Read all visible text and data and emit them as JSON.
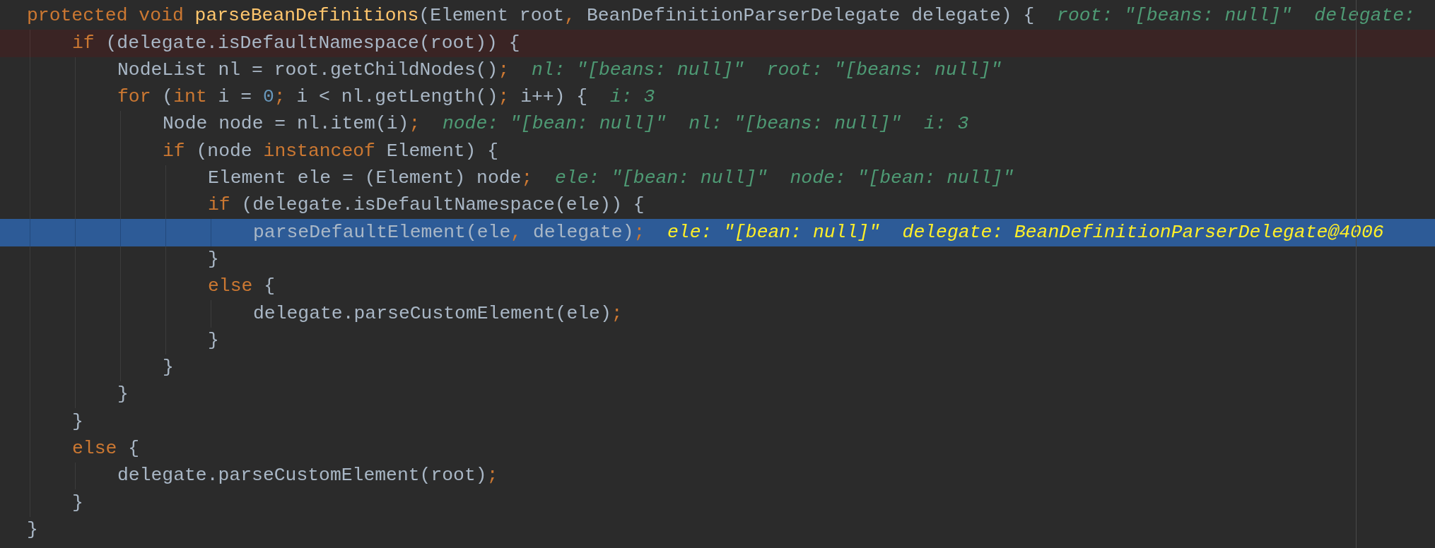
{
  "lines": [
    {
      "breakpoint": false,
      "current": false,
      "tokens": [
        {
          "kind": "keyword",
          "text": "protected void "
        },
        {
          "kind": "declaration",
          "text": "parseBeanDefinitions"
        },
        {
          "kind": "plain",
          "text": "(Element root"
        },
        {
          "kind": "punct",
          "text": ","
        },
        {
          "kind": "plain",
          "text": " BeanDefinitionParserDelegate delegate) {"
        }
      ],
      "values": [
        "root: \"[beans: null]\"",
        "delegate:"
      ],
      "children": [
        {
          "breakpoint": true,
          "current": false,
          "tokens": [
            {
              "kind": "keyword",
              "text": "if"
            },
            {
              "kind": "plain",
              "text": " (delegate.isDefaultNamespace(root)) {"
            }
          ],
          "children": [
            {
              "breakpoint": false,
              "current": false,
              "tokens": [
                {
                  "kind": "plain",
                  "text": "NodeList nl = root.getChildNodes()"
                },
                {
                  "kind": "punct",
                  "text": ";"
                }
              ],
              "values": [
                "nl: \"[beans: null]\"",
                "root: \"[beans: null]\""
              ]
            },
            {
              "breakpoint": false,
              "current": false,
              "tokens": [
                {
                  "kind": "keyword",
                  "text": "for"
                },
                {
                  "kind": "plain",
                  "text": " ("
                },
                {
                  "kind": "keyword",
                  "text": "int"
                },
                {
                  "kind": "plain",
                  "text": " i = "
                },
                {
                  "kind": "number",
                  "text": "0"
                },
                {
                  "kind": "punct",
                  "text": ";"
                },
                {
                  "kind": "plain",
                  "text": " i < nl.getLength()"
                },
                {
                  "kind": "punct",
                  "text": ";"
                },
                {
                  "kind": "plain",
                  "text": " i++) {"
                }
              ],
              "values": [
                "i: 3"
              ],
              "children": [
                {
                  "breakpoint": false,
                  "current": false,
                  "tokens": [
                    {
                      "kind": "plain",
                      "text": "Node node = nl.item(i)"
                    },
                    {
                      "kind": "punct",
                      "text": ";"
                    }
                  ],
                  "values": [
                    "node: \"[bean: null]\"",
                    "nl: \"[beans: null]\"",
                    "i: 3"
                  ]
                },
                {
                  "breakpoint": false,
                  "current": false,
                  "tokens": [
                    {
                      "kind": "keyword",
                      "text": "if"
                    },
                    {
                      "kind": "plain",
                      "text": " (node "
                    },
                    {
                      "kind": "keyword",
                      "text": "instanceof"
                    },
                    {
                      "kind": "plain",
                      "text": " Element) {"
                    }
                  ],
                  "children": [
                    {
                      "breakpoint": false,
                      "current": false,
                      "tokens": [
                        {
                          "kind": "plain",
                          "text": "Element ele = (Element) node"
                        },
                        {
                          "kind": "punct",
                          "text": ";"
                        }
                      ],
                      "values": [
                        "ele: \"[bean: null]\"",
                        "node: \"[bean: null]\""
                      ]
                    },
                    {
                      "breakpoint": false,
                      "current": false,
                      "tokens": [
                        {
                          "kind": "keyword",
                          "text": "if"
                        },
                        {
                          "kind": "plain",
                          "text": " (delegate.isDefaultNamespace(ele)) {"
                        }
                      ],
                      "children": [
                        {
                          "breakpoint": false,
                          "current": true,
                          "tokens": [
                            {
                              "kind": "plain",
                              "text": "parseDefaultElement(ele"
                            },
                            {
                              "kind": "punct",
                              "text": ","
                            },
                            {
                              "kind": "plain",
                              "text": " delegate)"
                            },
                            {
                              "kind": "punct",
                              "text": ";"
                            }
                          ],
                          "values": [
                            "ele: \"[bean: null]\"",
                            "delegate: BeanDefinitionParserDelegate@4006"
                          ]
                        }
                      ]
                    },
                    {
                      "breakpoint": false,
                      "current": false,
                      "tokens": [
                        {
                          "kind": "plain",
                          "text": "}"
                        }
                      ]
                    },
                    {
                      "breakpoint": false,
                      "current": false,
                      "tokens": [
                        {
                          "kind": "keyword",
                          "text": "else"
                        },
                        {
                          "kind": "plain",
                          "text": " {"
                        }
                      ],
                      "children": [
                        {
                          "breakpoint": false,
                          "current": false,
                          "tokens": [
                            {
                              "kind": "plain",
                              "text": "delegate.parseCustomElement(ele)"
                            },
                            {
                              "kind": "punct",
                              "text": ";"
                            }
                          ]
                        }
                      ]
                    },
                    {
                      "breakpoint": false,
                      "current": false,
                      "tokens": [
                        {
                          "kind": "plain",
                          "text": "}"
                        }
                      ]
                    }
                  ]
                },
                {
                  "breakpoint": false,
                  "current": false,
                  "tokens": [
                    {
                      "kind": "plain",
                      "text": "}"
                    }
                  ]
                }
              ]
            },
            {
              "breakpoint": false,
              "current": false,
              "tokens": [
                {
                  "kind": "plain",
                  "text": "}"
                }
              ]
            }
          ]
        },
        {
          "breakpoint": false,
          "current": false,
          "tokens": [
            {
              "kind": "plain",
              "text": "}"
            }
          ]
        },
        {
          "breakpoint": false,
          "current": false,
          "tokens": [
            {
              "kind": "keyword",
              "text": "else"
            },
            {
              "kind": "plain",
              "text": " {"
            }
          ],
          "children": [
            {
              "breakpoint": false,
              "current": false,
              "tokens": [
                {
                  "kind": "plain",
                  "text": "delegate.parseCustomElement(root)"
                },
                {
                  "kind": "punct",
                  "text": ";"
                }
              ]
            }
          ]
        },
        {
          "breakpoint": false,
          "current": false,
          "tokens": [
            {
              "kind": "plain",
              "text": "}"
            }
          ]
        }
      ]
    },
    {
      "breakpoint": false,
      "current": false,
      "tokens": [
        {
          "kind": "plain",
          "text": "}"
        }
      ]
    }
  ]
}
